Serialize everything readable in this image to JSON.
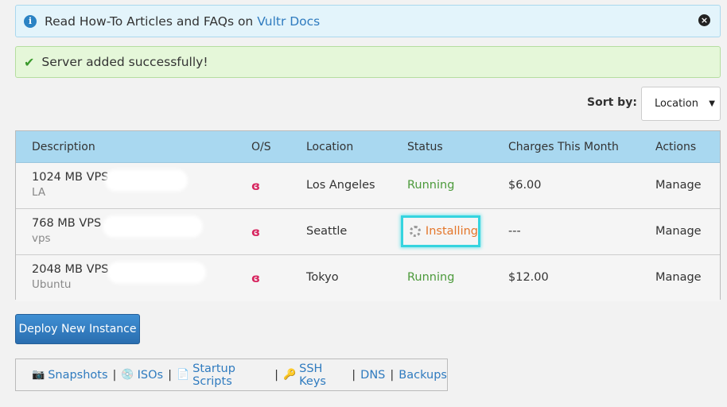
{
  "info_banner": {
    "text": "Read How-To Articles and FAQs on ",
    "link": "Vultr Docs",
    "icon": "info-icon",
    "close": "×"
  },
  "success_banner": {
    "text": "Server added successfully!",
    "icon": "check-icon"
  },
  "sort": {
    "label": "Sort by:",
    "selected": "Location"
  },
  "table": {
    "headers": [
      "Description",
      "O/S",
      "Location",
      "Status",
      "Charges This Month",
      "Actions"
    ],
    "rows": [
      {
        "description": "1024 MB VPS -",
        "label": "LA",
        "os_icon": "debian-icon",
        "location": "Los Angeles",
        "status": "Running",
        "charges": "$6.00",
        "action": "Manage"
      },
      {
        "description": "768 MB VPS -",
        "label": "vps",
        "os_icon": "debian-icon",
        "location": "Seattle",
        "status": "Installing",
        "charges": "---",
        "action": "Manage"
      },
      {
        "description": "2048 MB VPS -",
        "label": "Ubuntu",
        "os_icon": "debian-icon",
        "location": "Tokyo",
        "status": "Running",
        "charges": "$12.00",
        "action": "Manage"
      }
    ]
  },
  "deploy_button": "Deploy New Instance",
  "links": {
    "snapshots": "Snapshots",
    "isos": "ISOs",
    "startup_scripts": "Startup Scripts",
    "ssh_keys": "SSH Keys",
    "dns": "DNS",
    "backups": "Backups",
    "separator": "|"
  },
  "colors": {
    "status_running": "#4c9a3b",
    "status_installing": "#e4762a",
    "link": "#2f7bbf",
    "header_bg": "#a9d8f0",
    "highlight": "#35d4df"
  }
}
